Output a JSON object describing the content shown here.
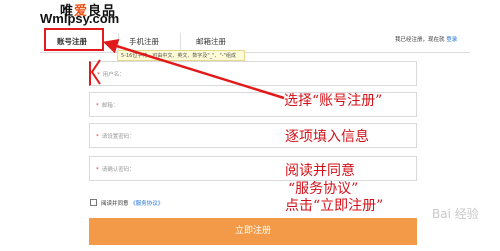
{
  "logo": {
    "cn_prefix": "唯",
    "cn_accent": "爱",
    "cn_suffix": "良品",
    "url": "Wmlpsy.com"
  },
  "tabs": [
    {
      "label": "账号注册"
    },
    {
      "label": "手机注册"
    },
    {
      "label": "邮箱注册"
    }
  ],
  "login_hint": {
    "text": "我已经注册，现在就 ",
    "link": "登录"
  },
  "tooltip": "5-16位字符，可由中文、英文、数字及\"_\"、\"-\"组成",
  "fields": [
    {
      "label": "用户名"
    },
    {
      "label": "邮箱"
    },
    {
      "label": "请设置密码"
    },
    {
      "label": "请确认密码"
    }
  ],
  "agree": {
    "text": "阅读并同意 ",
    "link": "《服务协议》"
  },
  "submit_label": "立即注册",
  "annotations": {
    "step1": "选择“账号注册”",
    "step2": "逐项填入信息",
    "step3": "阅读并同意",
    "step4": "“服务协议”",
    "step5": "点击“立即注册”"
  },
  "watermark": "Bai 经验",
  "colors": {
    "annotation_red": "#d4111a",
    "submit_orange": "#f29a47",
    "link_blue": "#1d6fd6"
  }
}
